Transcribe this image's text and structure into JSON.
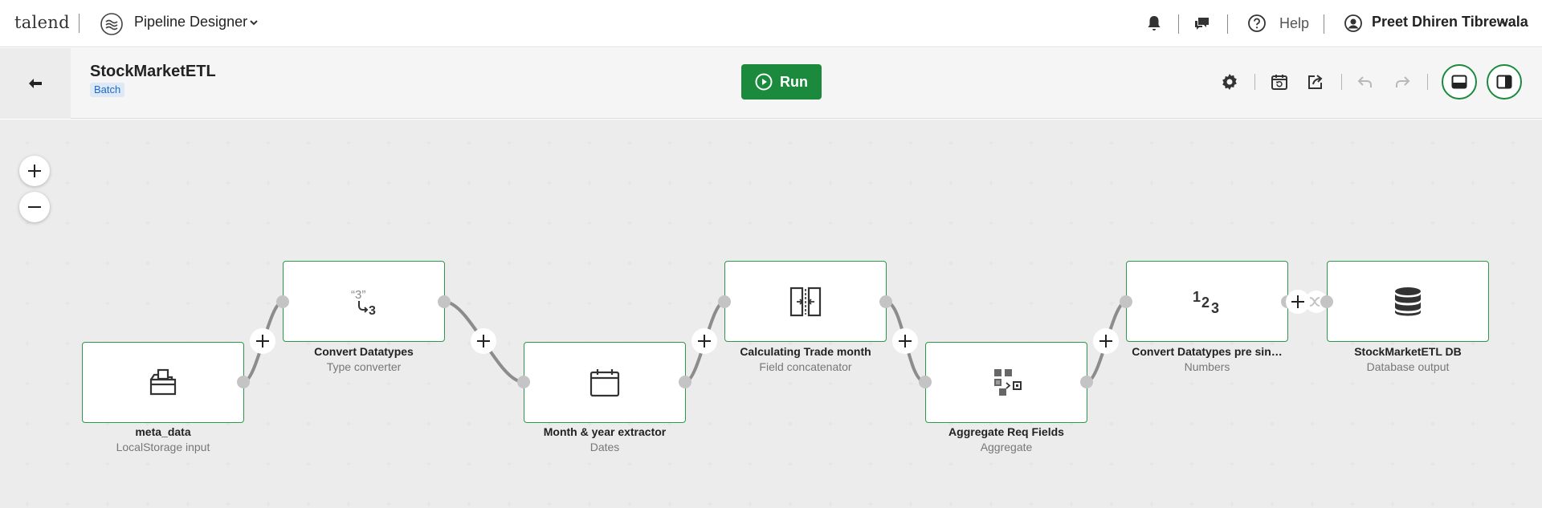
{
  "topbar": {
    "brand": "talend",
    "app_name": "Pipeline Designer",
    "help_label": "Help",
    "user_name": "Preet Dhiren Tibrewala"
  },
  "pipeline": {
    "title": "StockMarketETL",
    "badge": "Batch",
    "run_label": "Run"
  },
  "colors": {
    "accent_green": "#1b8a3c",
    "node_border": "#2a9a4a",
    "badge_bg": "#dde9f7",
    "badge_text": "#1f6ac7"
  },
  "nodes": [
    {
      "label": "meta_data",
      "type": "LocalStorage input",
      "icon": "folder-icon"
    },
    {
      "label": "Convert Datatypes",
      "type": "Type converter",
      "icon": "type-converter-icon"
    },
    {
      "label": "Month & year extractor",
      "type": "Dates",
      "icon": "calendar-icon"
    },
    {
      "label": "Calculating Trade month",
      "type": "Field concatenator",
      "icon": "concatenate-icon"
    },
    {
      "label": "Aggregate Req Fields",
      "type": "Aggregate",
      "icon": "aggregate-icon"
    },
    {
      "label": "Convert Datatypes pre sin…",
      "type": "Numbers",
      "icon": "numbers-icon"
    },
    {
      "label": "StockMarketETL DB",
      "type": "Database output",
      "icon": "database-icon"
    }
  ]
}
